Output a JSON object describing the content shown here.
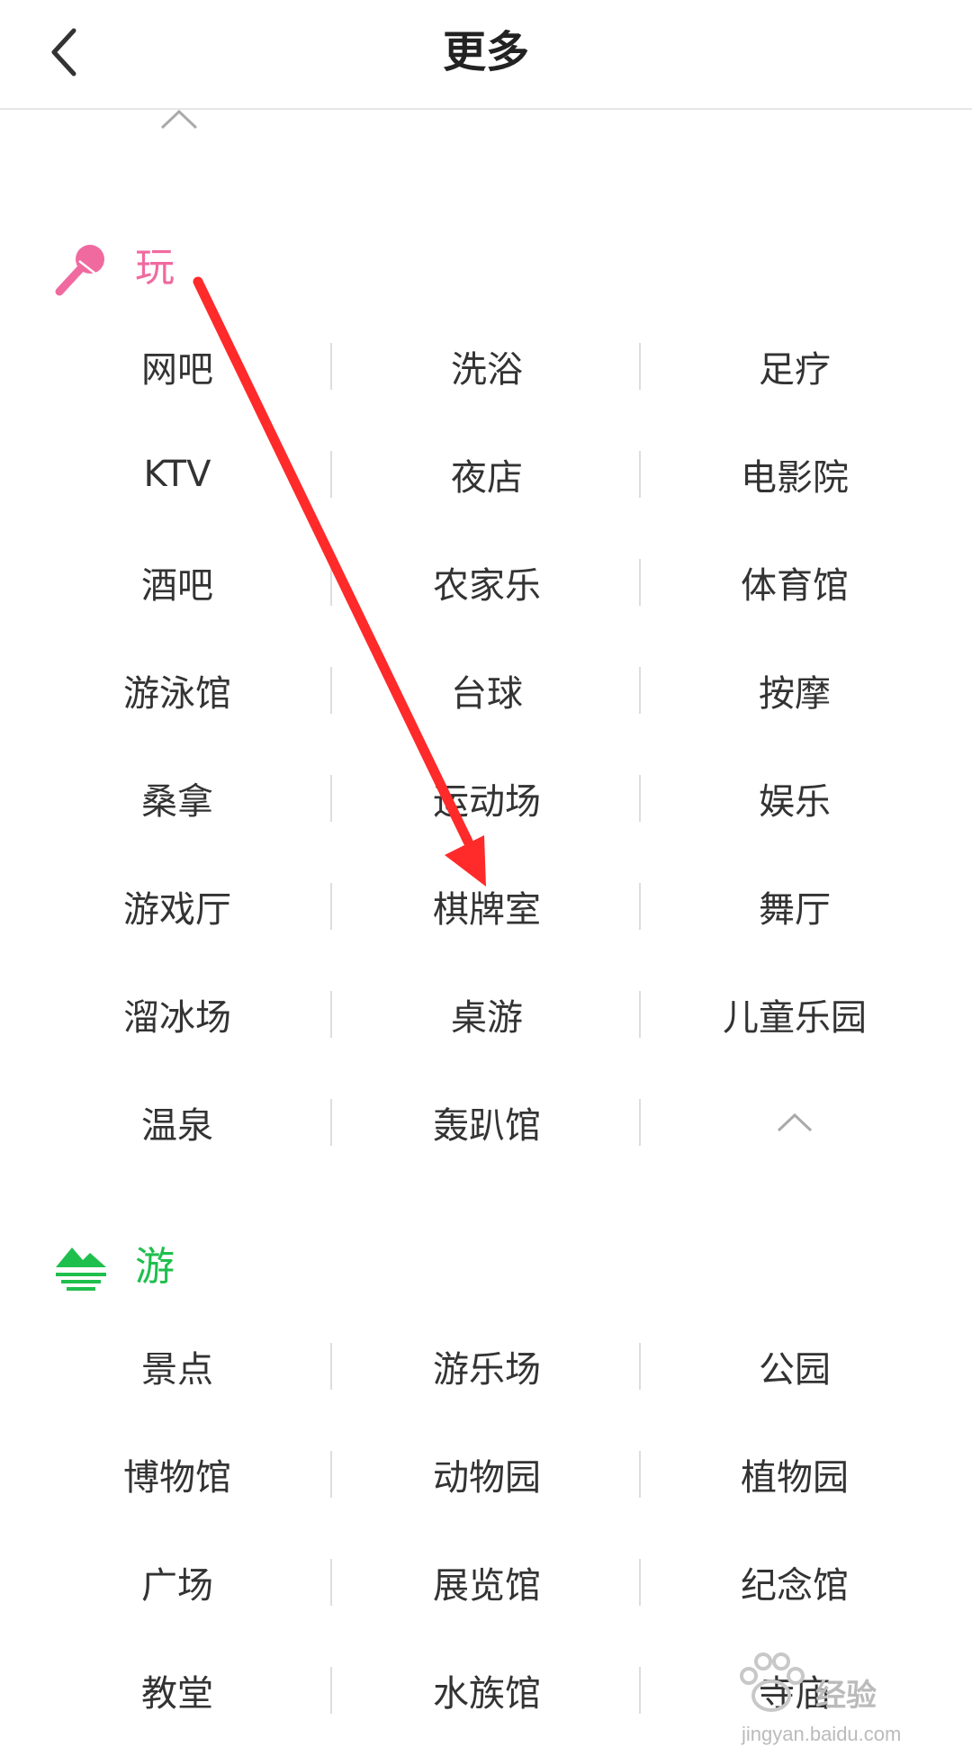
{
  "header": {
    "title": "更多",
    "back_icon": "chevron-left-icon"
  },
  "colors": {
    "play_accent": "#f06aa0",
    "travel_accent": "#1fbf4d",
    "annotation_arrow": "#ff2a2a"
  },
  "sections": {
    "play": {
      "title": "玩",
      "icon": "microphone-icon",
      "items": [
        "网吧",
        "洗浴",
        "足疗",
        "KTV",
        "夜店",
        "电影院",
        "酒吧",
        "农家乐",
        "体育馆",
        "游泳馆",
        "台球",
        "按摩",
        "桑拿",
        "运动场",
        "娱乐",
        "游戏厅",
        "棋牌室",
        "舞厅",
        "溜冰场",
        "桌游",
        "儿童乐园",
        "温泉",
        "轰趴馆"
      ]
    },
    "travel": {
      "title": "游",
      "icon": "mountain-icon",
      "items": [
        "景点",
        "游乐场",
        "公园",
        "博物馆",
        "动物园",
        "植物园",
        "广场",
        "展览馆",
        "纪念馆",
        "教堂",
        "水族馆",
        "寺庙"
      ]
    }
  },
  "watermark": {
    "brand": "经验",
    "url": "jingyan.baidu.com"
  }
}
